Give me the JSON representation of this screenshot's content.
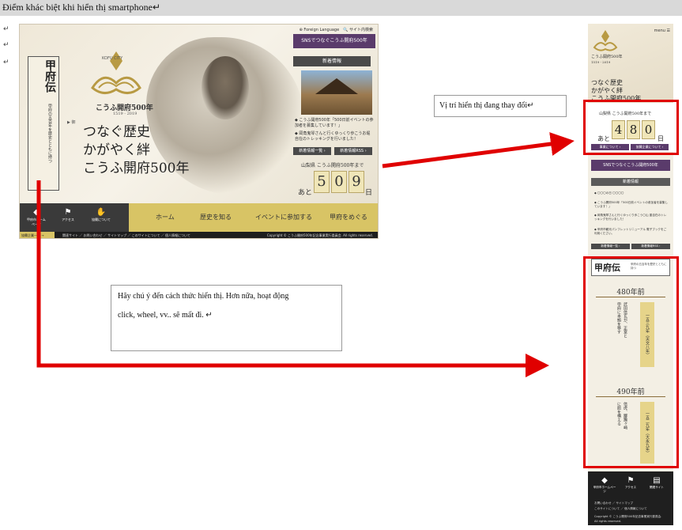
{
  "heading": {
    "text": "Điểm khác biệt khi hiển thị smartphone↵"
  },
  "para_marks": [
    "↵",
    "↵",
    "↵"
  ],
  "callouts": {
    "position_changed": "Vị trí hiển thị đang thay đổi↵",
    "notice_line1": "Hãy chú ý đến cách thức hiển thị. Hơn nữa, hoạt động",
    "notice_line2": "click, wheel, vv.. sẽ mất đi. ↵"
  },
  "desktop": {
    "topbar": "⊕ Foreign Language　🔍 サイト内検索",
    "sns_banner": "SNSでつなぐこうふ開府500年",
    "news_heading": "新着情報",
    "news_items": [
      "◆ こうふ開府500年「500日前イベントの参加者を募集しています！」",
      "◆ 岡角鬼琴さんと行くゆっくり歩こうお堀自在のトレッキングを行いました！"
    ],
    "news_buttons": [
      "新着情報一覧 ›",
      "新着情報RSS ›"
    ],
    "countdown_label": "山梨県 こうふ開府500年まで",
    "countdown_prefix": "あと",
    "countdown_digits": [
      "5",
      "0",
      "9"
    ],
    "countdown_suffix": "日",
    "logo_city": "KOFU CITY",
    "logo_title": "こうふ開府500年",
    "logo_years": "1519 - 2019",
    "tagline_lines": [
      "つなぐ歴史",
      "かがやく絆",
      "こうふ開府500年"
    ],
    "koufu_title": "甲府伝",
    "koufu_sub": "甲府の五百年を歴史とともに持つ",
    "uchi": "▶ 御",
    "nav_icons": [
      {
        "icon": "◆",
        "label": "甲府市ホームページ"
      },
      {
        "icon": "⚑",
        "label": "アクセス"
      },
      {
        "icon": "✋",
        "label": "協賛について"
      }
    ],
    "nav_items": [
      "ホーム",
      "歴史を知る",
      "イベントに参加する",
      "甲府をめぐる"
    ],
    "footer_yellow": "協賛企業一覧 →",
    "footer_links": "関連サイト ／ お問い合わせ ／ サイトマップ ／ このサイトについて ／ 個人情報について",
    "footer_copy": "Copyright © こうふ開府500年記念事業実行委員会. All rights reserved."
  },
  "phone": {
    "menu": "menu ☰",
    "logo_name": "こうふ開府500年",
    "logo_years": "1519 - 2019",
    "tagline_lines": [
      "つなぐ歴史",
      "かがやく絆",
      "こうふ開府500年"
    ],
    "countdown_label": "山梨県 こうふ開府500年まで",
    "countdown_prefix": "あと",
    "countdown_digits": [
      "4",
      "8",
      "0"
    ],
    "countdown_suffix": "日",
    "buttons": [
      "事業について ›",
      "協賛企業について ›"
    ],
    "sns_banner": "SNSでつなぐこうふ開府500年",
    "news_heading": "新着情報",
    "news_items": [
      "◆ 〇〇〇の日 〇〇〇〇",
      "◆ こうふ開府500年「500日前イベントの参加者を募集しています！」",
      "◆ 岡角鬼琴さんと行くゆっくり歩こう〇山 墨自在のトレッキングを行いました！",
      "◆ 甲府市観光パンフレットリニューアル 電子ブックをご利用ください。"
    ],
    "news_buttons": [
      "新着情報一覧 ›",
      "新着情報RSS ›"
    ],
    "koufu_title": "甲府伝",
    "koufu_sub": "甲府の五百年を歴史とともに持つ",
    "timeline": [
      {
        "year": "480年前",
        "text_a": "武田信玄が、正室と",
        "text_b": "甲府に本拠を移す",
        "scroll": "一五三九年（天文八年）"
      },
      {
        "year": "490年前",
        "text_a": "信虎、躑躅ヶ崎",
        "text_b": "に館を構える",
        "scroll": "一五二九年（大永九年）"
      }
    ],
    "footer_icons": [
      {
        "icon": "◆",
        "label": "甲府市ホームページ"
      },
      {
        "icon": "⚑",
        "label": "アクセス"
      },
      {
        "icon": "▤",
        "label": "関連サイト"
      }
    ],
    "footer_lines": [
      "お問い合わせ ／ サイトマップ",
      "このサイトについて ／ 個人情報について",
      "Copyright © こうふ開府500年記念事業実行委員会.",
      "All rights reserved."
    ]
  },
  "colors": {
    "highlight": "#e00000",
    "accent_purple": "#5a3b6b",
    "accent_gold": "#d8c465"
  }
}
